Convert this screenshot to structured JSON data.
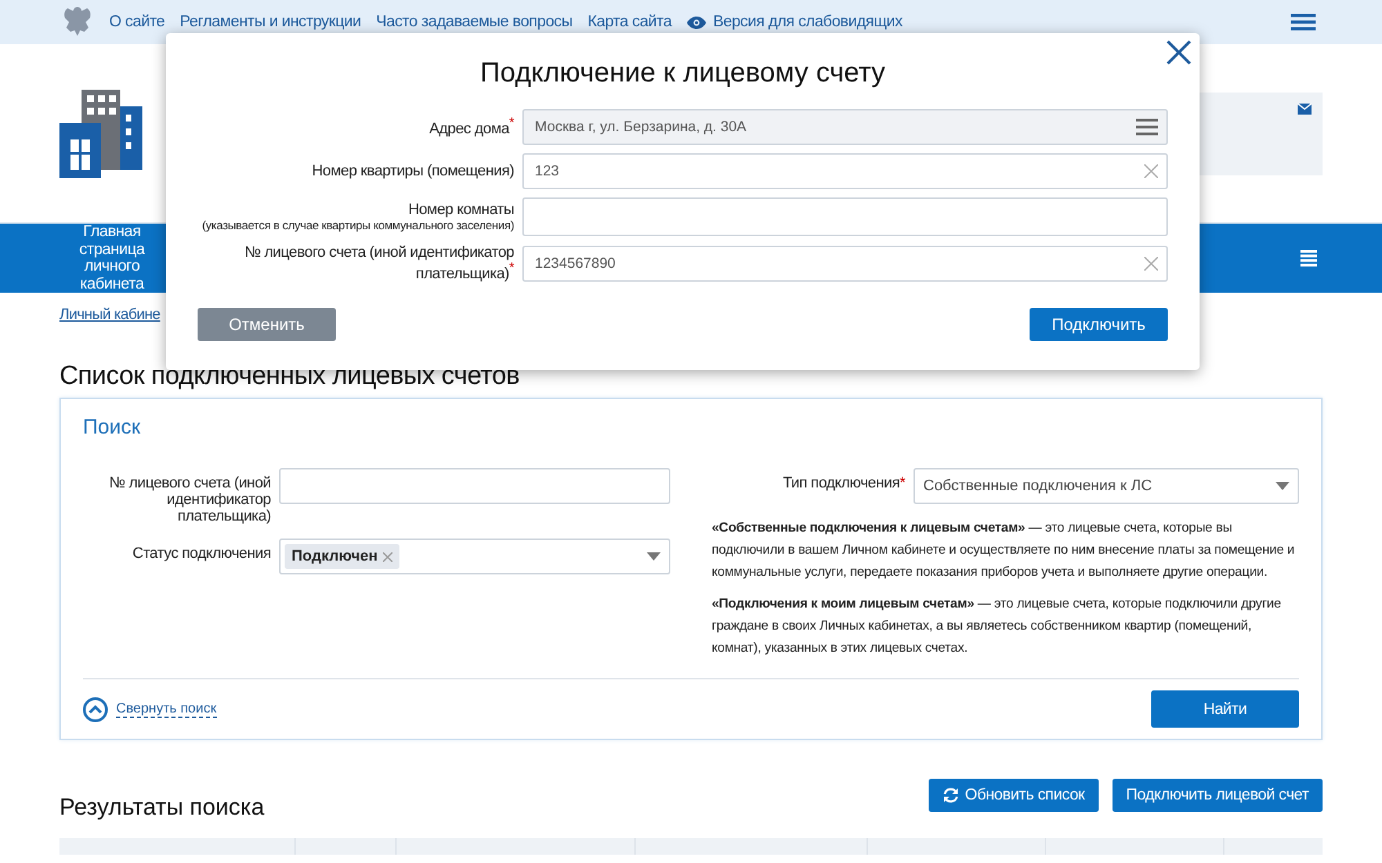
{
  "top_bar": {
    "links": [
      "О сайте",
      "Регламенты и инструкции",
      "Часто задаваемые вопросы",
      "Карта сайта",
      "Версия для слабовидящих"
    ]
  },
  "main_nav": {
    "items": [
      {
        "label": "Главная страница личного кабинета",
        "selected": false
      }
    ]
  },
  "breadcrumb": "Личный кабине",
  "page_title": "Список подключенных лицевых счетов",
  "search_panel": {
    "title": "Поиск",
    "left_fields": [
      {
        "kind": "text",
        "label": "№ лицевого счета (иной идентификатор плательщика)"
      },
      {
        "kind": "tags",
        "label": "Статус подключения",
        "tags": [
          "Подключен"
        ]
      }
    ],
    "type_field": {
      "kind": "select",
      "label": "Тип подключения",
      "required_mark": "*",
      "value": "Собственные подключения к ЛС"
    },
    "notes": [
      "**«Собственные подключения к лицевым счетам»** — это лицевые счета, которые вы подключили в вашем Личном кабинете и осуществляете по ним внесение платы за помещение и коммунальные услуги, передаете показания приборов учета и выполняете другие операции.",
      "**«Подключения к моим лицевым счетам»** — это лицевые счета, которые подключили другие граждане в своих Личных кабинетах, а вы являетесь собственником квартир (помещений, комнат), указанных в этих лицевых счетах."
    ],
    "collapse_link": "Свернуть поиск",
    "search_button": "Найти"
  },
  "results": {
    "title": "Результаты поиска",
    "buttons": [
      {
        "kind": "refresh",
        "label": "Обновить список"
      },
      {
        "kind": "plain",
        "label": "Подключить лицевой счет"
      }
    ]
  },
  "modal": {
    "title": "Подключение к лицевому счету",
    "fields": [
      {
        "kind": "menu",
        "label": "Адрес дома",
        "required_mark": "*",
        "value": "Москва г, ул. Берзарина, д. 30А"
      },
      {
        "kind": "clear",
        "label": "Номер квартиры (помещения)",
        "value": "123"
      },
      {
        "kind": "plain",
        "label": "Номер комнаты",
        "hint": "(указывается в случае квартиры коммунального заселения)"
      },
      {
        "kind": "clear",
        "label": "№ лицевого счета (иной идентификатор плательщика)",
        "required_mark": "*",
        "value": "1234567890"
      }
    ],
    "cancel_button": "Отменить",
    "connect_button": "Подключить"
  }
}
